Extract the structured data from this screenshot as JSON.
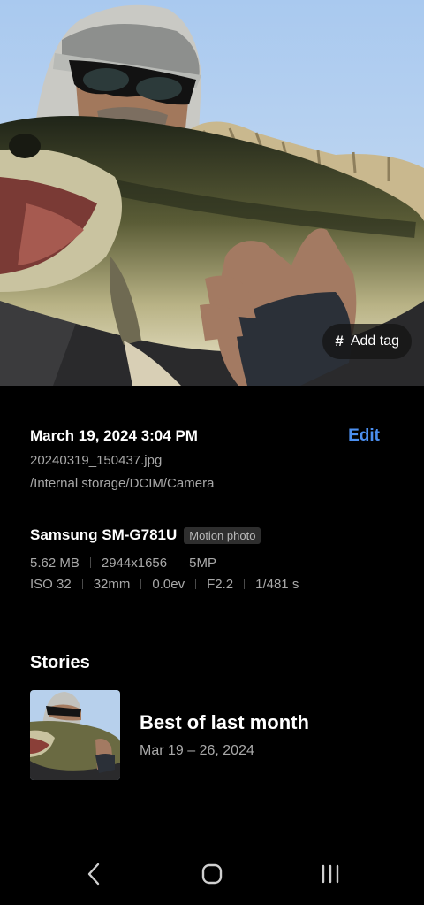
{
  "photo": {
    "add_tag_label": "Add tag",
    "add_tag_symbol": "#"
  },
  "details": {
    "datetime": "March 19, 2024 3:04 PM",
    "edit_label": "Edit",
    "filename": "20240319_150437.jpg",
    "path": "/Internal storage/DCIM/Camera",
    "device": "Samsung SM-G781U",
    "badge": "Motion photo",
    "file_meta": [
      "5.62 MB",
      "2944x1656",
      "5MP"
    ],
    "camera_meta": [
      "ISO 32",
      "32mm",
      "0.0ev",
      "F2.2",
      "1/481 s"
    ],
    "accent_color": "#4b8ff0"
  },
  "stories": {
    "title": "Stories",
    "items": [
      {
        "title": "Best of last month",
        "date": "Mar 19 – 26, 2024"
      }
    ]
  },
  "nav": {
    "icons": [
      "back-icon",
      "home-icon",
      "recent-apps-icon"
    ]
  }
}
